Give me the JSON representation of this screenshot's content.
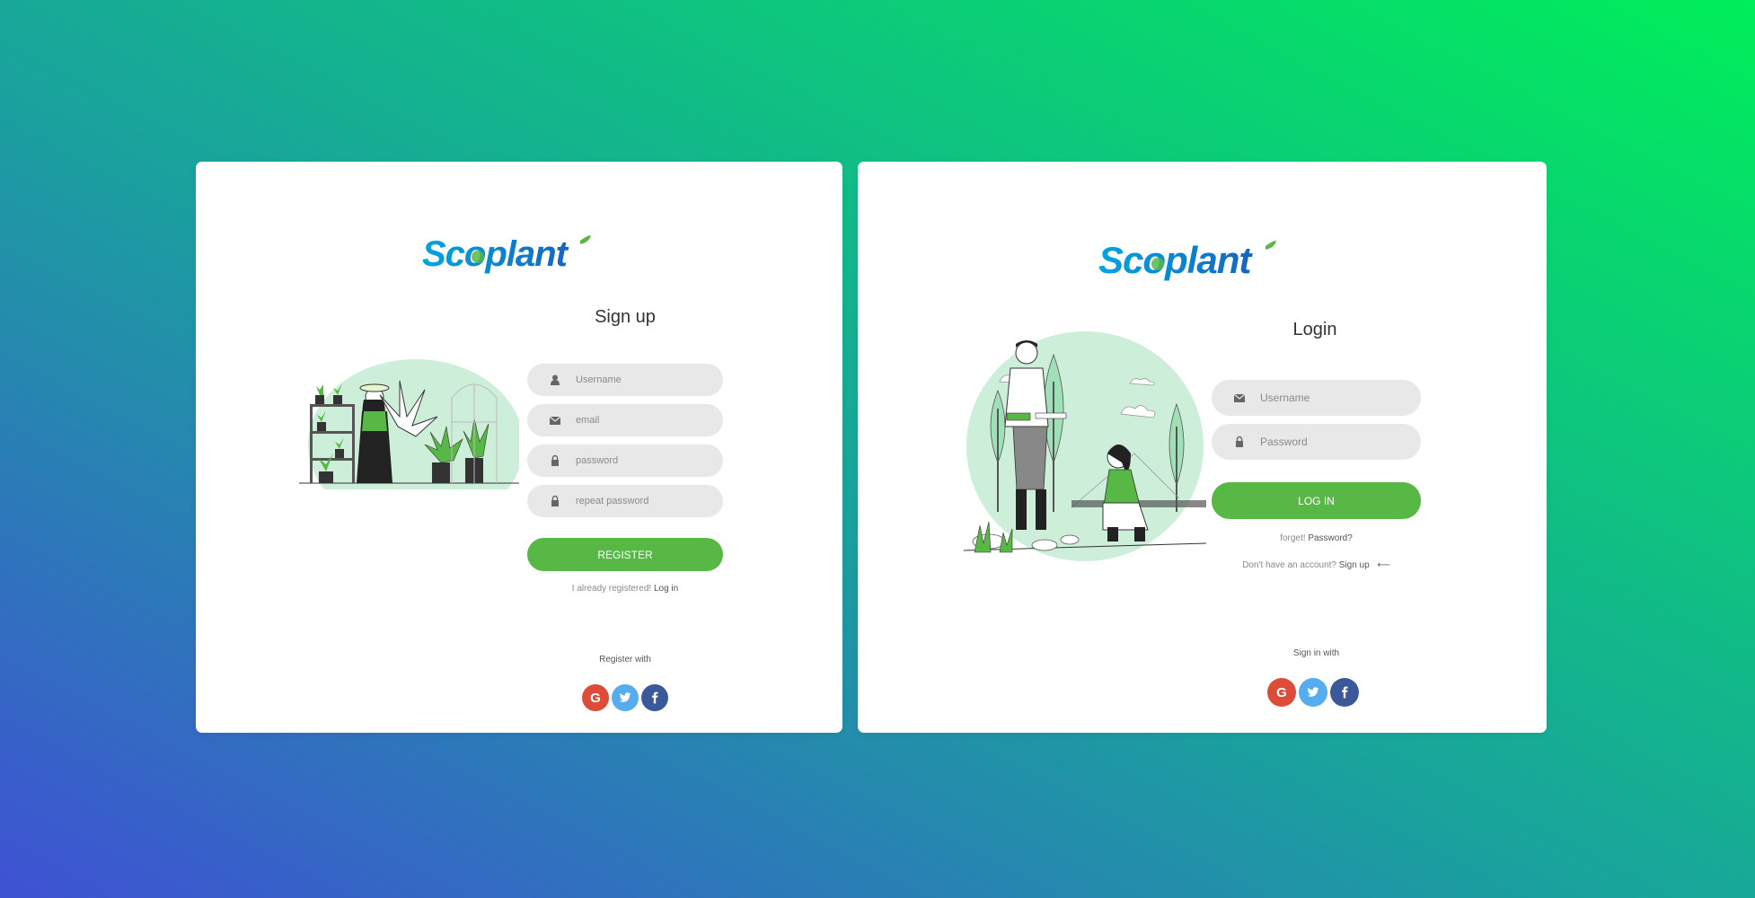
{
  "brand": {
    "name": "Scoplant",
    "blue": "#1565c0",
    "cyan": "#00a6e0",
    "leaf": "#57b846"
  },
  "signup": {
    "title": "Sign up",
    "fields": [
      {
        "icon": "user-icon",
        "placeholder": "Username"
      },
      {
        "icon": "envelope-icon",
        "placeholder": "email"
      },
      {
        "icon": "lock-icon",
        "placeholder": "password"
      },
      {
        "icon": "lock-icon",
        "placeholder": "repeat password"
      }
    ],
    "button_label": "REGISTER",
    "already_text": "I already registered!",
    "login_link": "Log in",
    "register_with": "Register with"
  },
  "login": {
    "title": "Login",
    "fields": [
      {
        "icon": "envelope-icon",
        "placeholder": "Username"
      },
      {
        "icon": "lock-icon",
        "placeholder": "Password"
      }
    ],
    "button_label": "LOG IN",
    "forget_text": "forget!",
    "password_link": "Password?",
    "no_account_text": "Don't have an account?",
    "signup_link": "Sign up",
    "arrow": "⟵",
    "sign_in_with": "Sign in with"
  },
  "social": {
    "google": {
      "label": "G",
      "color": "#dd4b39"
    },
    "twitter": {
      "color": "#55acee"
    },
    "facebook": {
      "color": "#3b5998"
    }
  },
  "colors": {
    "button_green": "#57b846",
    "field_bg": "#e8e8e8",
    "illustration_green": "#c8f0d8"
  }
}
